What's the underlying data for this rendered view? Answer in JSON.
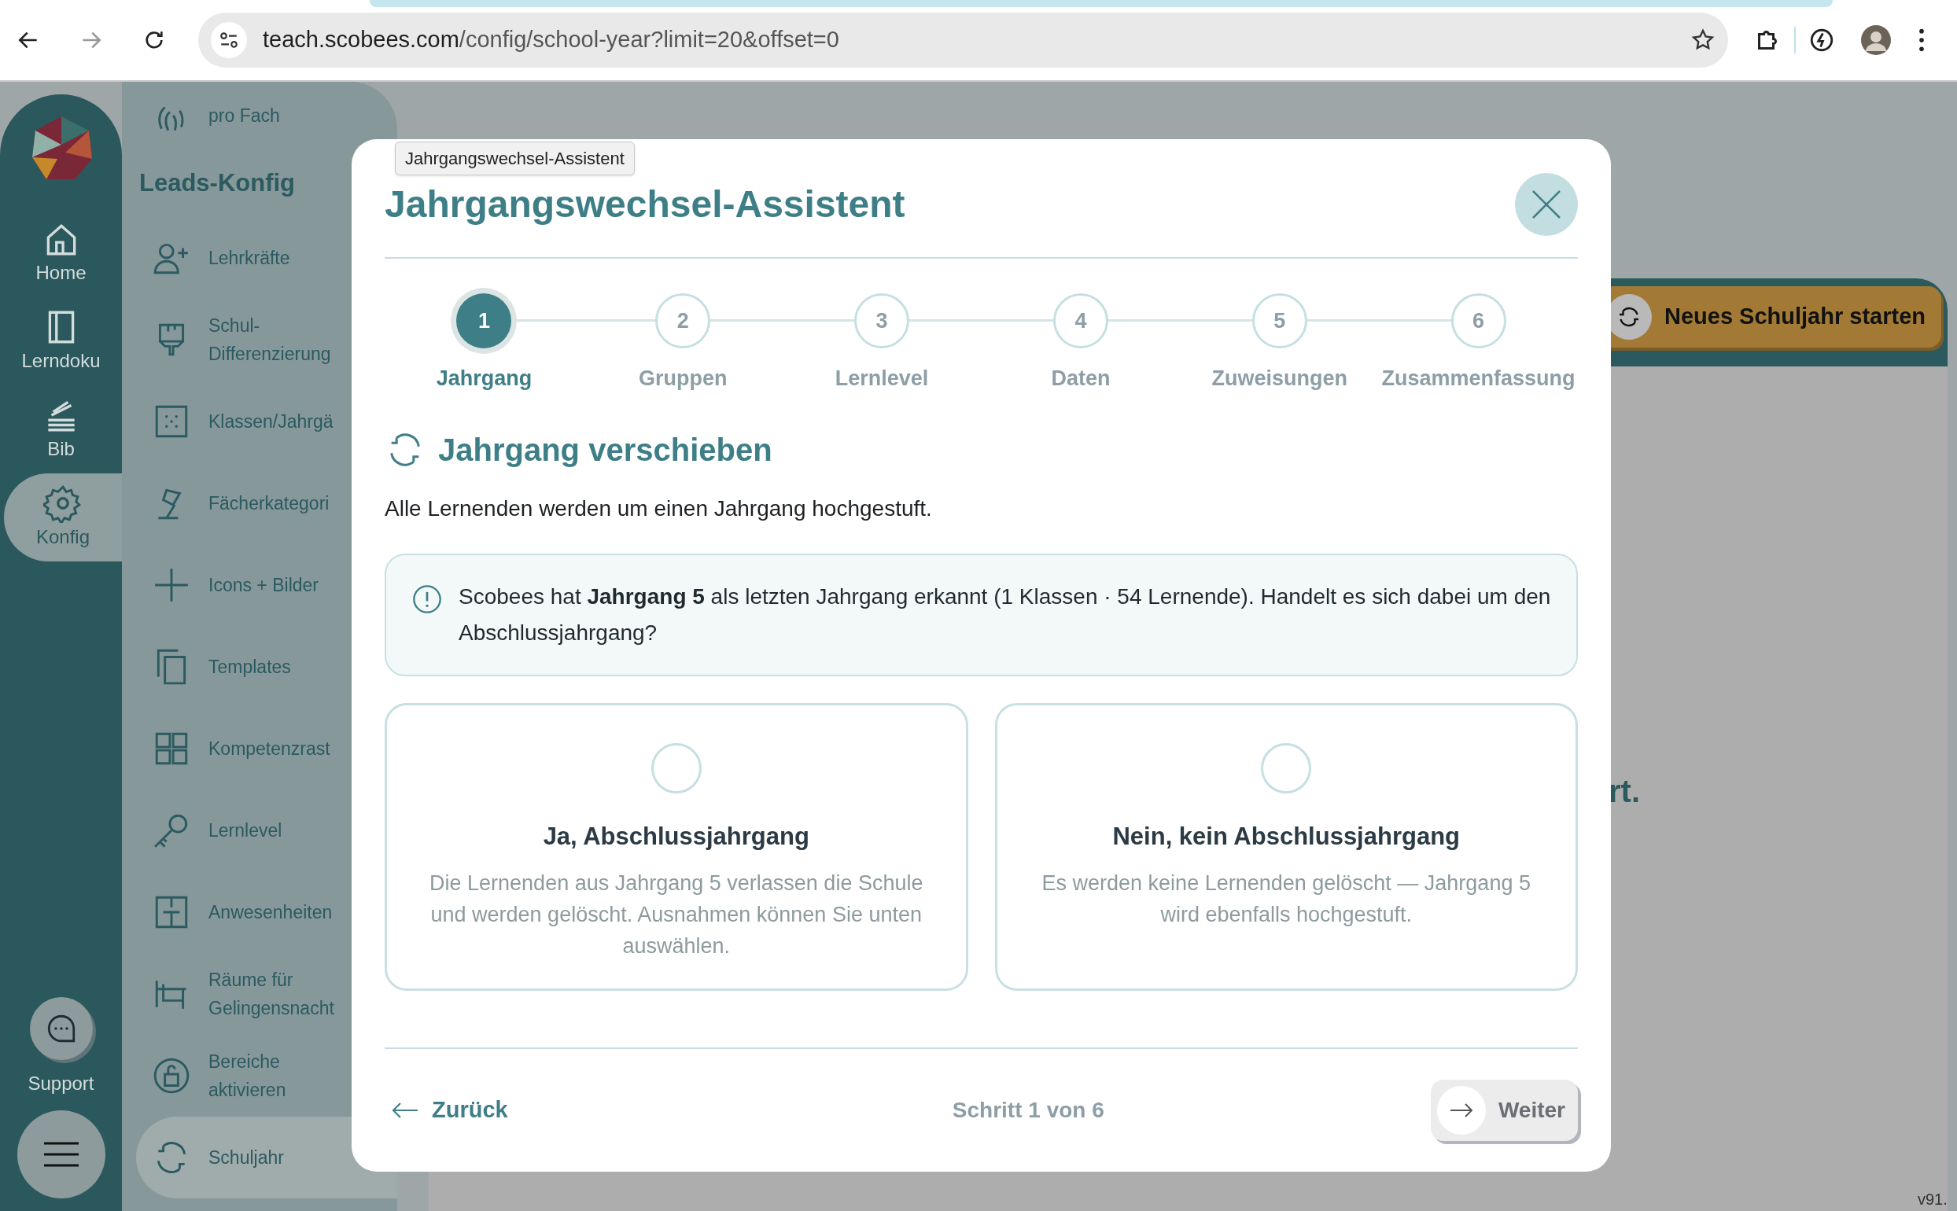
{
  "browser": {
    "url_host": "teach.scobees.com",
    "url_path": "/config/school-year?limit=20&offset=0"
  },
  "rail": {
    "items": [
      {
        "label": "Home",
        "selected": false
      },
      {
        "label": "Lerndoku",
        "selected": false
      },
      {
        "label": "Bib",
        "selected": false
      },
      {
        "label": "Konfig",
        "selected": true
      }
    ],
    "support": "Support"
  },
  "nav": {
    "items": [
      {
        "kind": "item",
        "label": "pro Fach",
        "selected": false
      },
      {
        "kind": "heading",
        "label": "Leads-Konfig"
      },
      {
        "kind": "item",
        "label": "Lehrkräfte",
        "selected": false
      },
      {
        "kind": "item",
        "label": "Schul-\nDifferenzierung",
        "selected": false
      },
      {
        "kind": "item",
        "label": "Klassen/Jahrgä",
        "selected": false
      },
      {
        "kind": "item",
        "label": "Fächerkategori",
        "selected": false
      },
      {
        "kind": "item",
        "label": "Icons + Bilder",
        "selected": false
      },
      {
        "kind": "item",
        "label": "Templates",
        "selected": false
      },
      {
        "kind": "item",
        "label": "Kompetenzrast",
        "selected": false
      },
      {
        "kind": "item",
        "label": "Lernlevel",
        "selected": false
      },
      {
        "kind": "item",
        "label": "Anwesenheiten",
        "selected": false
      },
      {
        "kind": "item",
        "label": "Räume für\nGelingensnacht",
        "selected": false
      },
      {
        "kind": "item",
        "label": "Bereiche\naktivieren",
        "selected": false
      },
      {
        "kind": "item",
        "label": "Schuljahr",
        "selected": true
      }
    ]
  },
  "background": {
    "button": "Neues Schuljahr starten",
    "text_fragment": "rt.",
    "version": "v91."
  },
  "tooltip": "Jahrgangswechsel-Assistent",
  "modal": {
    "title": "Jahrgangswechsel-Assistent",
    "steps": [
      {
        "number": "1",
        "label": "Jahrgang",
        "selected": true
      },
      {
        "number": "2",
        "label": "Gruppen",
        "selected": false
      },
      {
        "number": "3",
        "label": "Lernlevel",
        "selected": false
      },
      {
        "number": "4",
        "label": "Daten",
        "selected": false
      },
      {
        "number": "5",
        "label": "Zuweisungen",
        "selected": false
      },
      {
        "number": "6",
        "label": "Zusammenfassung",
        "selected": false
      }
    ],
    "section_title": "Jahrgang verschieben",
    "intro": "Alle Lernenden werden um einen Jahrgang hochgestuft.",
    "info": "Scobees hat **Jahrgang 5** als letzten Jahrgang erkannt (1 Klassen · 54 Lernende). Handelt es sich dabei um den Abschlussjahrgang?",
    "options": [
      {
        "title": "Ja, Abschlussjahrgang",
        "description": "Die Lernenden aus Jahrgang 5 verlassen die Schule und werden gelöscht. Ausnahmen können Sie unten auswählen.",
        "selected": false
      },
      {
        "title": "Nein, kein Abschlussjahrgang",
        "description": "Es werden keine Lernenden gelöscht — Jahrgang 5 wird ebenfalls hochgestuft.",
        "selected": false
      }
    ],
    "back": "Zurück",
    "step_counter": "Schritt 1 von 6",
    "next": "Weiter"
  }
}
